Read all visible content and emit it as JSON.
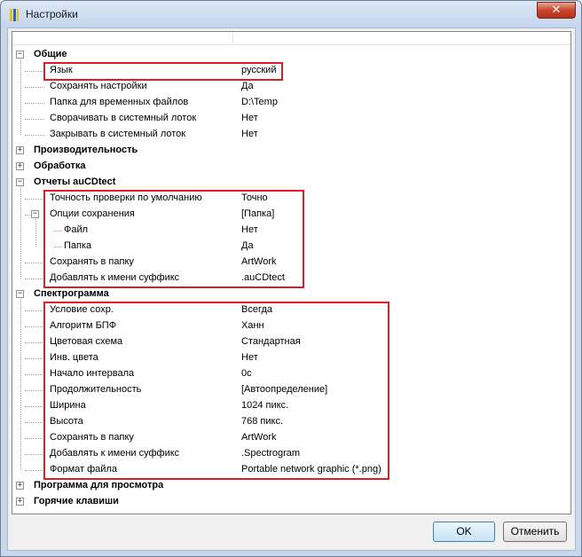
{
  "window": {
    "title": "Настройки"
  },
  "buttons": {
    "ok": "OK",
    "cancel": "Отменить"
  },
  "accent": {
    "highlight": "#e01c24"
  },
  "rows": [
    {
      "type": "cat",
      "label": "Общие",
      "expanded": true
    },
    {
      "type": "prop",
      "label": "Язык",
      "value": "русский"
    },
    {
      "type": "prop",
      "label": "Сохранять настройки",
      "value": "Да"
    },
    {
      "type": "prop",
      "label": "Папка для временных файлов",
      "value": "D:\\Temp"
    },
    {
      "type": "prop",
      "label": "Сворачивать в системный лоток",
      "value": "Нет"
    },
    {
      "type": "prop",
      "label": "Закрывать в системный лоток",
      "value": "Нет"
    },
    {
      "type": "cat",
      "label": "Производительность",
      "expanded": false
    },
    {
      "type": "cat",
      "label": "Обработка",
      "expanded": false
    },
    {
      "type": "cat",
      "label": "Отчеты auCDtect",
      "expanded": true
    },
    {
      "type": "prop",
      "label": "Точность проверки по умолчанию",
      "value": "Точно"
    },
    {
      "type": "prop",
      "label": "Опции сохранения",
      "value": "[Папка]",
      "expanded": true
    },
    {
      "type": "sub",
      "label": "Файл",
      "value": "Нет"
    },
    {
      "type": "sub",
      "label": "Папка",
      "value": "Да"
    },
    {
      "type": "prop",
      "label": "Сохранять в папку",
      "value": "ArtWork"
    },
    {
      "type": "prop",
      "label": "Добавлять к имени суффикс",
      "value": ".auCDtect"
    },
    {
      "type": "cat",
      "label": "Спектрограмма",
      "expanded": true
    },
    {
      "type": "prop",
      "label": "Условие сохр.",
      "value": "Всегда"
    },
    {
      "type": "prop",
      "label": "Алгоритм БПФ",
      "value": "Ханн"
    },
    {
      "type": "prop",
      "label": "Цветовая схема",
      "value": "Стандартная"
    },
    {
      "type": "prop",
      "label": "Инв. цвета",
      "value": "Нет"
    },
    {
      "type": "prop",
      "label": "Начало интервала",
      "value": "0с"
    },
    {
      "type": "prop",
      "label": "Продолжительность",
      "value": "[Автоопределение]"
    },
    {
      "type": "prop",
      "label": "Ширина",
      "value": "1024 пикс."
    },
    {
      "type": "prop",
      "label": "Высота",
      "value": "768 пикс."
    },
    {
      "type": "prop",
      "label": "Сохранять в папку",
      "value": "ArtWork"
    },
    {
      "type": "prop",
      "label": "Добавлять к имени суффикс",
      "value": ".Spectrogram"
    },
    {
      "type": "prop",
      "label": "Формат файла",
      "value": "Portable network graphic (*.png)"
    },
    {
      "type": "cat",
      "label": "Программа для просмотра",
      "expanded": false
    },
    {
      "type": "cat",
      "label": "Горячие клавиши",
      "expanded": false
    }
  ]
}
